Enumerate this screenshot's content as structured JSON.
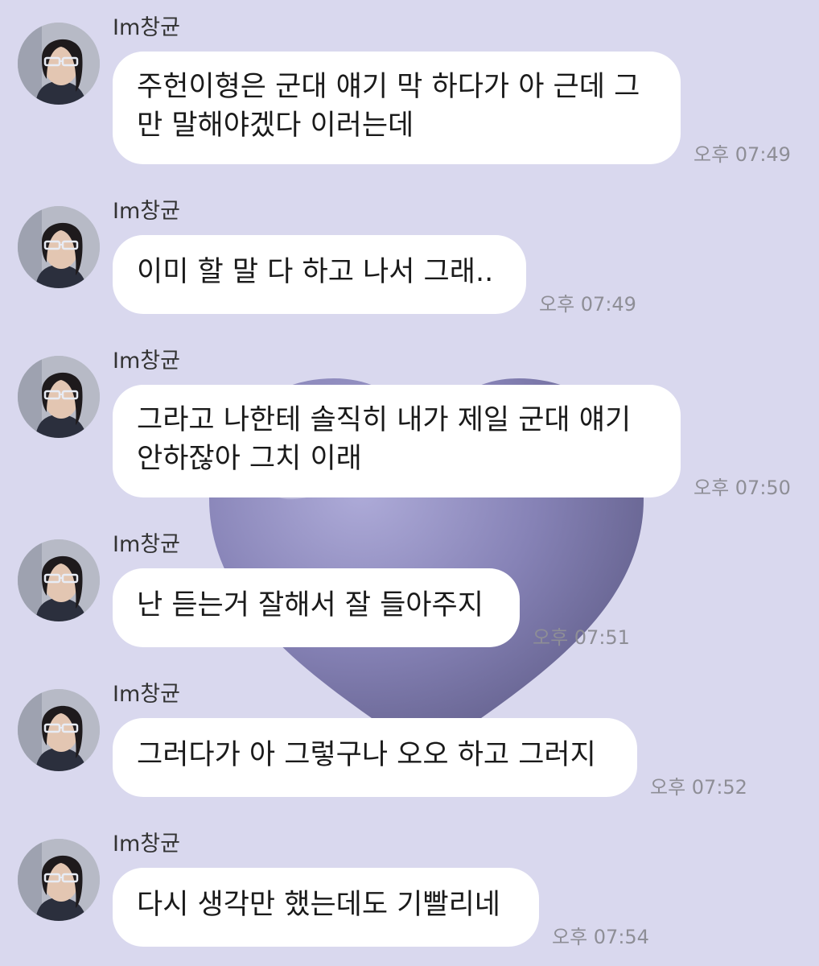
{
  "messages": [
    {
      "sender": "Im창균",
      "text": "주헌이형은 군대 얘기 막 하다가 아 근데 그\n만 말해야겠다 이러는데",
      "time": "오후 07:49"
    },
    {
      "sender": "Im창균",
      "text": "이미 할 말 다 하고 나서 그래..",
      "time": "오후 07:49"
    },
    {
      "sender": "Im창균",
      "text": "그라고 나한테 솔직히 내가 제일 군대 얘기\n안하잖아 그치 이래",
      "time": "오후 07:50"
    },
    {
      "sender": "Im창균",
      "text": "난 듣는거 잘해서 잘 들아주지",
      "time": "오후 07:51"
    },
    {
      "sender": "Im창균",
      "text": "그러다가 아 그렇구나 오오 하고 그러지",
      "time": "오후 07:52"
    },
    {
      "sender": "Im창균",
      "text": "다시 생각만 했는데도 기빨리네",
      "time": "오후 07:54"
    }
  ],
  "theme": {
    "background": "#d9d8ee",
    "bubble": "#ffffff",
    "timestamp_color": "#8e8e96",
    "wallpaper_heart": "#7c78ad"
  },
  "icons": {
    "avatar": "profile-photo",
    "wallpaper": "purple-heart"
  }
}
